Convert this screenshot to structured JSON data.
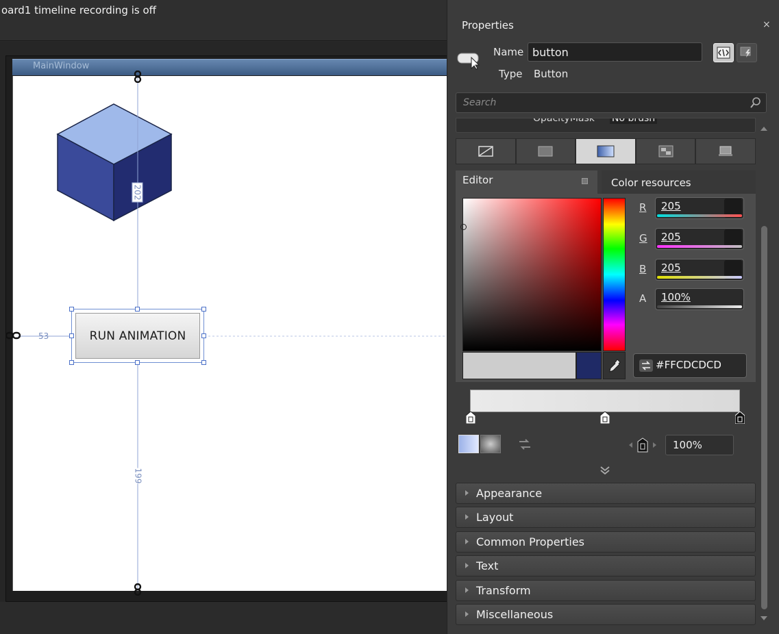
{
  "artboard": {
    "recording_status": "oard1 timeline recording is off",
    "window_title": "MainWindow",
    "button_label": "RUN ANIMATION",
    "dim_top": "202",
    "dim_left": "53",
    "dim_bottom": "199"
  },
  "properties": {
    "title": "Properties",
    "close_glyph": "×",
    "name_label": "Name",
    "name_value": "button",
    "type_label": "Type",
    "type_value": "Button",
    "search_placeholder": "Search",
    "opacity_mask_label": "OpacityMask",
    "opacity_mask_value": "No brush",
    "brush_tabs": [
      "no-brush",
      "solid-color-brush",
      "gradient-brush",
      "tile-brush",
      "brush-resources"
    ],
    "active_brush_tab": "gradient-brush",
    "editor_tab": "Editor",
    "color_resources_tab": "Color resources",
    "channels": {
      "r_label": "R",
      "r_value": "205",
      "g_label": "G",
      "g_value": "205",
      "b_label": "B",
      "b_value": "205",
      "a_label": "A",
      "a_value": "100%"
    },
    "hex_value": "#FFCDCDCD",
    "current_color": "#cdcdcd",
    "previous_color": "#1f2a66",
    "gradient_offset": "100%",
    "categories": [
      "Appearance",
      "Layout",
      "Common Properties",
      "Text",
      "Transform",
      "Miscellaneous"
    ]
  }
}
